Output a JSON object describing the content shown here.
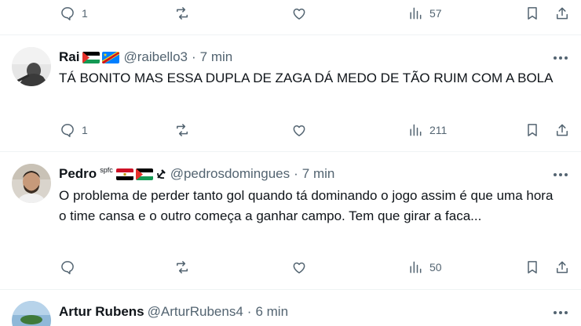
{
  "tweets": [
    {
      "counts": {
        "replies": "1",
        "reposts": "",
        "likes": "",
        "views": "57"
      }
    },
    {
      "name": "Rai",
      "flags": [
        "palestine-flag",
        "dr-congo-flag"
      ],
      "handle": "@raibello3",
      "dot": "·",
      "time": "7 min",
      "text": "TÁ BONITO MAS ESSA DUPLA DE ZAGA DÁ MEDO DE TÃO RUIM COM A BOLA",
      "counts": {
        "replies": "1",
        "reposts": "",
        "likes": "",
        "views": "211"
      }
    },
    {
      "name": "Pedro",
      "name_suffix": "spfc",
      "flags": [
        "egypt-flag",
        "palestine-flag",
        "hammer-sickle-emoji"
      ],
      "handle": "@pedrosdomingues",
      "dot": "·",
      "time": "7 min",
      "text": "O problema de perder tanto gol quando tá dominando o jogo assim é que uma hora o time cansa e o outro começa a ganhar campo. Tem que girar a faca...",
      "counts": {
        "replies": "",
        "reposts": "",
        "likes": "",
        "views": "50"
      }
    },
    {
      "name": "Artur Rubens",
      "handle": "@ArturRubens4",
      "dot": "·",
      "time": "6 min"
    }
  ],
  "colors": {
    "text": "#0f1419",
    "secondary": "#536471",
    "divider": "#eff3f4"
  }
}
